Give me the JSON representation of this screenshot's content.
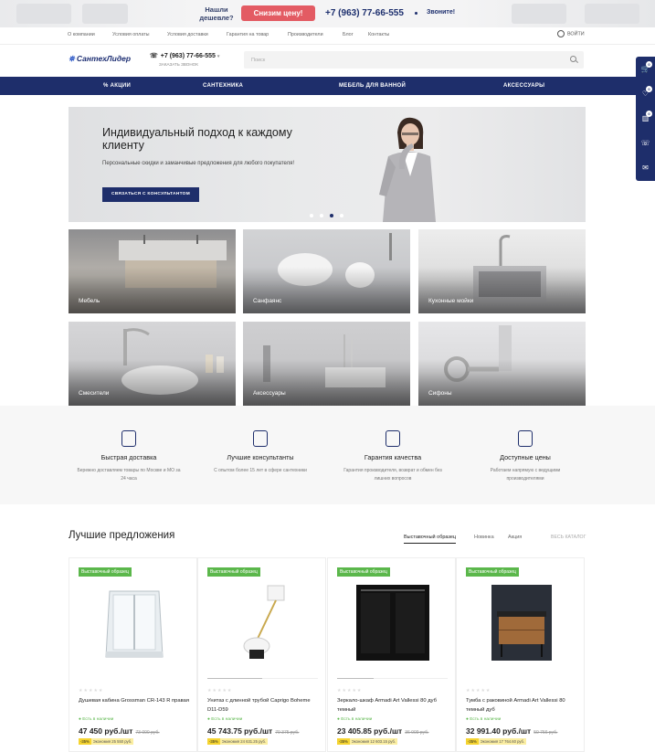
{
  "promo": {
    "question": "Нашли дешевле?",
    "button": "Снизим цену!",
    "phone": "+7 (963) 77-66-555",
    "call": "Звоните!"
  },
  "top_links": [
    "О компании",
    "Условия оплаты",
    "Условия доставки",
    "Гарантия на товар",
    "Производители",
    "Блог",
    "Контакты"
  ],
  "login": "ВОЙТИ",
  "header": {
    "logo": "СантехЛидер",
    "phone": "+7 (963) 77-66-555",
    "callback": "Заказать звонок",
    "search_placeholder": "Поиск"
  },
  "nav": [
    "АКЦИИ",
    "САНТЕХНИКА",
    "МЕБЕЛЬ ДЛЯ ВАННОЙ",
    "АКСЕССУАРЫ"
  ],
  "rail": {
    "counts": [
      "0",
      "0",
      "0"
    ]
  },
  "hero": {
    "title": "Индивидуальный подход к каждому клиенту",
    "subtitle": "Персональные скидки и заманчивые предложения для любого покупателя!",
    "cta": "СВЯЗАТЬСЯ С КОНСУЛЬТАНТОМ",
    "slides": 4,
    "active_slide": 3
  },
  "categories": [
    "Мебель",
    "Санфаянс",
    "Кухонные мойки",
    "Смесители",
    "Аксессуары",
    "Сифоны"
  ],
  "features": [
    {
      "title": "Быстрая доставка",
      "desc": "Бережно доставляем товары по Москве и МО за 24 часа"
    },
    {
      "title": "Лучшие консультанты",
      "desc": "С опытом более 15 лет в сфере сантехники"
    },
    {
      "title": "Гарантия качества",
      "desc": "Гарантия производителя, возврат и обмен без лишних вопросов"
    },
    {
      "title": "Доступные цены",
      "desc": "Работаем напрямую с ведущими производителями"
    }
  ],
  "best": {
    "title": "Лучшие предложения",
    "tabs": [
      "Выставочный образец",
      "Новинка",
      "Акция"
    ],
    "all": "ВЕСЬ КАТАЛОГ"
  },
  "products": [
    {
      "badge": "Выставочный образец",
      "name": "Душевая кабина Grossman CR-143 R правая",
      "stock": "Есть в наличии",
      "price": "47 450 руб./шт",
      "old": "73 000 руб.",
      "pct": "-35%",
      "save": "Экономия 25 550 руб."
    },
    {
      "badge": "Выставочный образец",
      "name": "Унитаз с длинной трубой Caprigo Boheme D11-D59",
      "stock": "Есть в наличии",
      "price": "45 743.75 руб./шт",
      "old": "70 375 руб.",
      "pct": "-35%",
      "save": "Экономия 24 631.25 руб."
    },
    {
      "badge": "Выставочный образец",
      "name": "Зеркало-шкаф Armadi Art Vallessi 80 дуб темный",
      "stock": "Есть в наличии",
      "price": "23 405.85 руб./шт",
      "old": "36 009 руб.",
      "pct": "-35%",
      "save": "Экономия 12 603.15 руб."
    },
    {
      "badge": "Выставочный образец",
      "name": "Тумба с раковиной Armadi Art Vallessi 80 темный дуб",
      "stock": "Есть в наличии",
      "price": "32 991.40 руб./шт",
      "old": "50 756 руб.",
      "pct": "-35%",
      "save": "Экономия 17 764.60 руб."
    }
  ],
  "colors": {
    "brand": "#1e2e6b",
    "accent": "#e35b63",
    "stock": "#5bb74b",
    "discount": "#f5d431"
  }
}
